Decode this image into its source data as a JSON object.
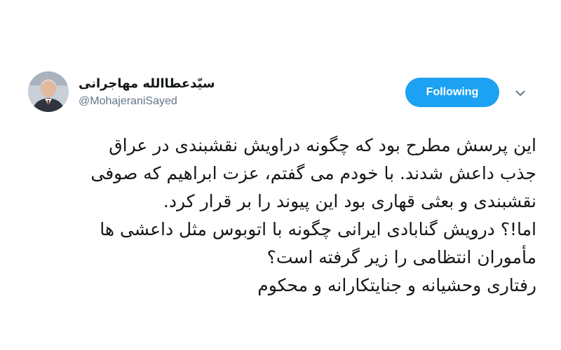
{
  "tweet": {
    "author": {
      "display_name": "سیّدعطاالله مهاجرانی",
      "handle": "@MohajeraniSayed"
    },
    "follow_button_label": "Following",
    "caret_icon": "chevron-down-icon",
    "body_lines": [
      "این پرسش مطرح بود که چگونه دراویش نقشبندی در عراق",
      "جذب داعش شدند. با خودم می گفتم، عزت ابراهیم که صوفی",
      "نقشبندی و بعثی قهاری بود این پیوند را بر قرار کرد.",
      "اما!؟ درویش گنابادی ایرانی چگونه با اتوبوس مثل داعشی ها",
      "مأموران انتظامی را زیر گرفته است؟",
      "رفتاری وحشیانه و جنایتکارانه و محکوم"
    ]
  },
  "colors": {
    "accent": "#1da1f2",
    "text": "#14171a",
    "muted": "#657786"
  }
}
